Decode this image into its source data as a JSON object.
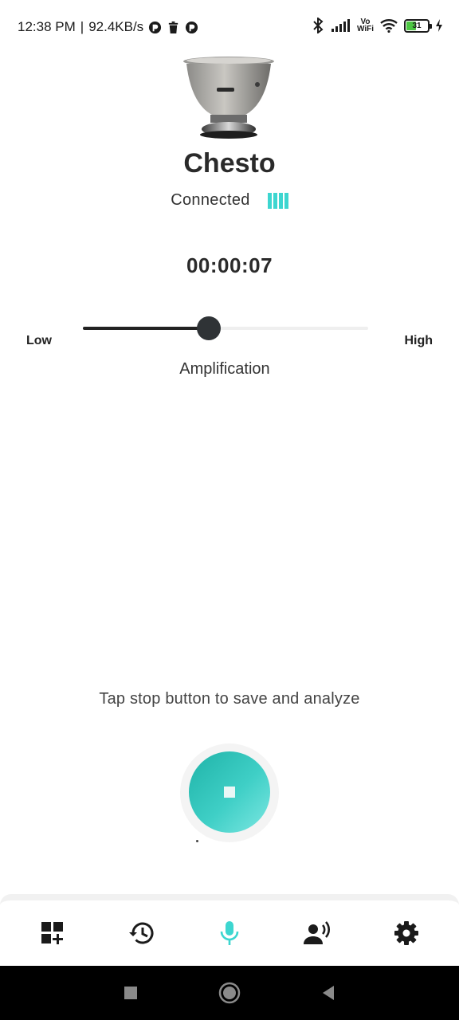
{
  "status_bar": {
    "time": "12:38 PM",
    "separator": "|",
    "speed": "92.4KB/s",
    "vowifi_top": "Vo",
    "vowifi_bottom": "WiFi",
    "battery_level": "31"
  },
  "device": {
    "image_icon": "stethoscope-chestpiece-image",
    "name": "Chesto",
    "status": "Connected",
    "battery_color": "#3dd6d0"
  },
  "recording": {
    "timer": "00:00:07"
  },
  "amplification": {
    "low_label": "Low",
    "high_label": "High",
    "label": "Amplification",
    "level": 0.44
  },
  "hint": {
    "text": "Tap stop button to save and analyze"
  },
  "record_button": {
    "icon": "stop-icon",
    "gradient_start": "#1fb3a8",
    "gradient_end": "#7de7e2"
  },
  "bottom_nav": {
    "items": [
      {
        "icon": "dashboard-add-icon"
      },
      {
        "icon": "history-icon"
      },
      {
        "icon": "microphone-icon",
        "active": true
      },
      {
        "icon": "voice-user-icon"
      },
      {
        "icon": "settings-gear-icon"
      }
    ],
    "active_color": "#3dd6d0"
  },
  "system_nav": {
    "items": [
      "recents-square-icon",
      "home-circle-icon",
      "back-triangle-icon"
    ]
  }
}
